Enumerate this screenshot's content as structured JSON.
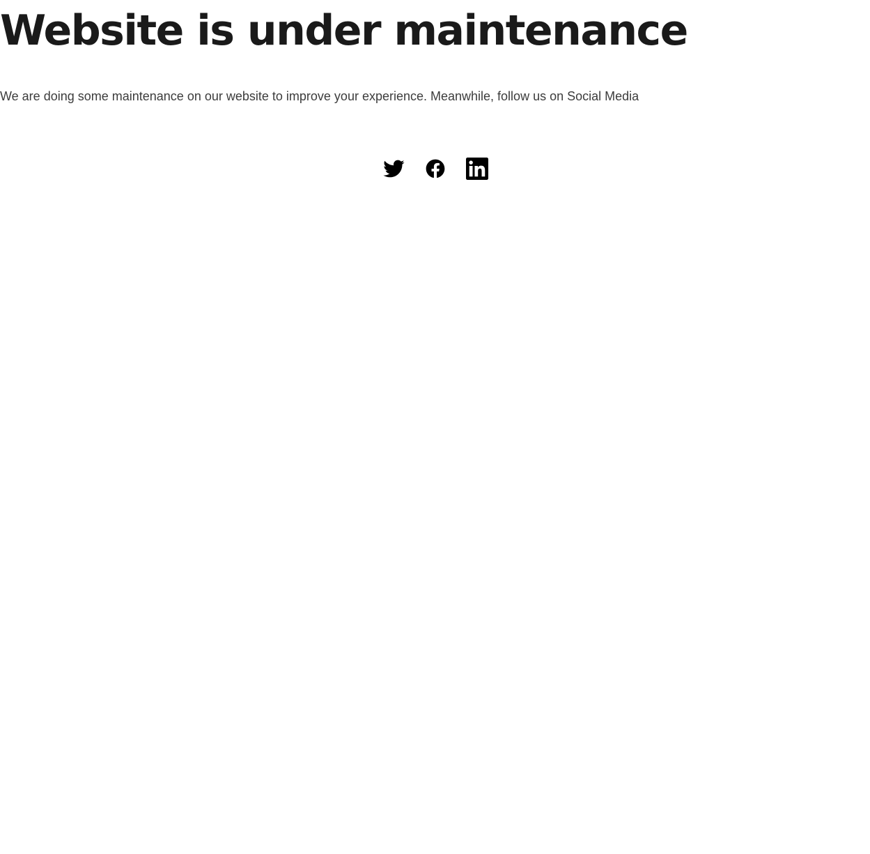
{
  "main": {
    "heading": "Website is under maintenance",
    "message": "We are doing some maintenance on our website to improve your experience. Meanwhile, follow us on Social Media"
  },
  "social": {
    "icon_color": "#000000",
    "links": [
      {
        "icon": "twitter-icon"
      },
      {
        "icon": "facebook-icon"
      },
      {
        "icon": "linkedin-icon"
      }
    ]
  }
}
